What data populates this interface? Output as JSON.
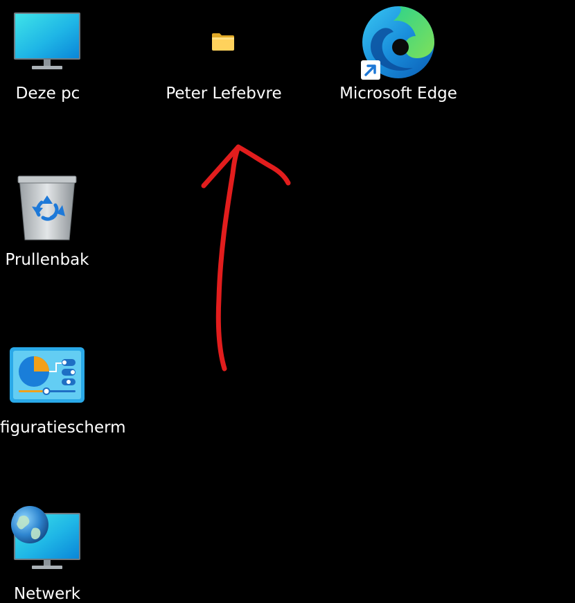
{
  "desktop": {
    "background_color": "#000000",
    "icons": [
      {
        "label": "Deze pc",
        "icon": "monitor-icon"
      },
      {
        "label": "Peter Lefebvre",
        "icon": "folder-icon"
      },
      {
        "label": "Microsoft Edge",
        "icon": "edge-icon",
        "shortcut_overlay": "shortcut-arrow-icon"
      },
      {
        "label": "Prullenbak",
        "icon": "recycle-bin-icon"
      },
      {
        "label": "figuratiescherm",
        "icon": "control-panel-icon"
      },
      {
        "label": "Netwerk",
        "icon": "network-icon"
      }
    ]
  },
  "annotation": {
    "type": "hand-drawn arrow",
    "color": "#e21d1d",
    "points_to": "Peter Lefebvre"
  }
}
